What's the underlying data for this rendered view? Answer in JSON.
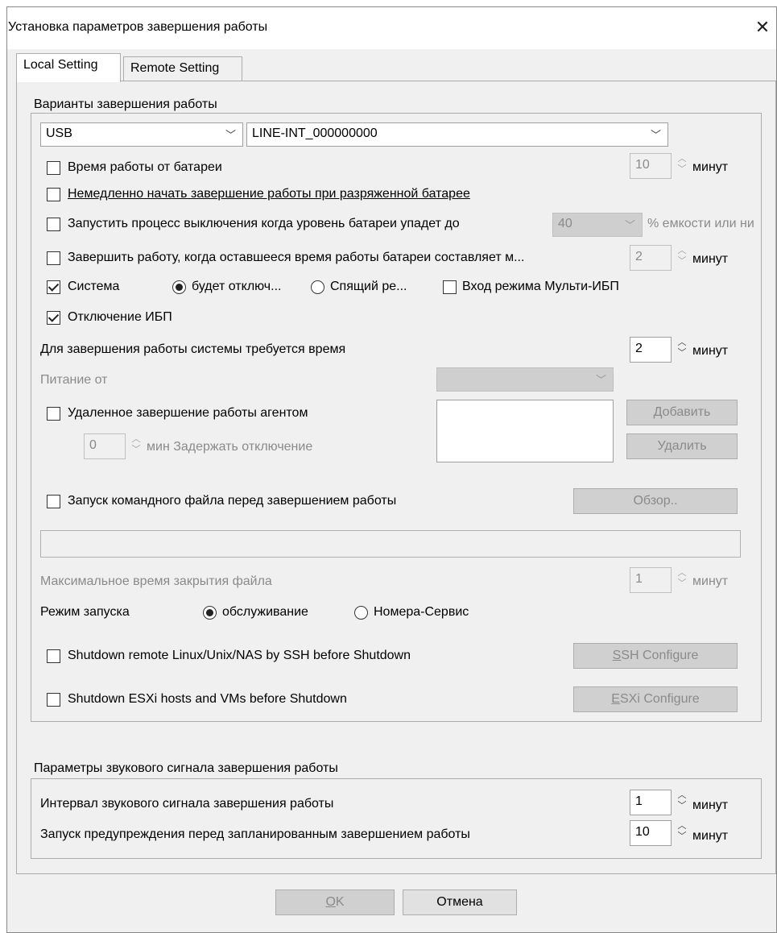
{
  "window": {
    "title": "Установка параметров завершения работы",
    "close_symbol": "✕"
  },
  "tabs": [
    {
      "label": "Local Setting",
      "active": true
    },
    {
      "label": "Remote Setting",
      "active": false
    }
  ],
  "shutdown_group": {
    "legend": "Варианты завершения работы",
    "port_select": "USB",
    "device_select": "LINE-INT_000000000",
    "battery_runtime": {
      "label": "Время работы от батареи",
      "checked": false,
      "value": "10",
      "unit": "минут"
    },
    "immediate_shutdown": {
      "label": "Немедленно начать завершение работы при разряженной батарее",
      "checked": false
    },
    "battery_level": {
      "label": "Запустить процесс выключения когда уровень батареи упадет до",
      "checked": false,
      "value": "40",
      "suffix": "% емкости или ни"
    },
    "remaining_time": {
      "label": "Завершить работу, когда оставшееся время работы батареи составляет м...",
      "checked": false,
      "value": "2",
      "unit": "минут"
    },
    "system": {
      "label": "Система",
      "checked": true
    },
    "radio_shutdown": {
      "label": "будет отключ...",
      "selected": true
    },
    "radio_sleep": {
      "label": "Спящий ре...",
      "selected": false
    },
    "multi_ups": {
      "label": "Вход режима Мульти-ИБП",
      "checked": false
    },
    "ups_off": {
      "label": "Отключение ИБП",
      "checked": true
    },
    "system_time": {
      "label": "Для завершения работы системы требуется время",
      "value": "2",
      "unit": "минут"
    },
    "power_from": {
      "label": "Питание от",
      "value": ""
    },
    "remote_agent": {
      "label": "Удаленное завершение работы агентом",
      "checked": false
    },
    "delay": {
      "value": "0",
      "label": "мин Задержать отключение"
    },
    "add_button": "Добавить",
    "delete_button": "Удалить",
    "command_file": {
      "label": "Запуск командного файла перед завершением работы",
      "checked": false
    },
    "browse_button": "Обзор..",
    "command_path": "",
    "max_close_time": {
      "label": "Максимальное время закрытия файла",
      "value": "1",
      "unit": "минут"
    },
    "launch_mode": {
      "label": "Режим запуска",
      "option1": "обслуживание",
      "option2": "Номера-Сервис",
      "selected": "option1"
    },
    "ssh": {
      "label": "Shutdown remote Linux/Unix/NAS by SSH before Shutdown",
      "checked": false,
      "button_mnemonic": "S",
      "button_rest": "SH Configure"
    },
    "esxi": {
      "label": "Shutdown ESXi hosts and VMs before Shutdown",
      "checked": false,
      "button_mnemonic": "E",
      "button_rest": "SXi Configure"
    }
  },
  "beep_group": {
    "legend": "Параметры звукового сигнала завершения работы",
    "interval": {
      "label": "Интервал звукового сигнала завершения работы",
      "value": "1",
      "unit": "минут"
    },
    "warning": {
      "label": "Запуск предупреждения перед запланированным завершением работы",
      "value": "10",
      "unit": "минут"
    }
  },
  "footer": {
    "ok_mnemonic": "O",
    "ok_rest": "K",
    "cancel": "Отмена"
  }
}
